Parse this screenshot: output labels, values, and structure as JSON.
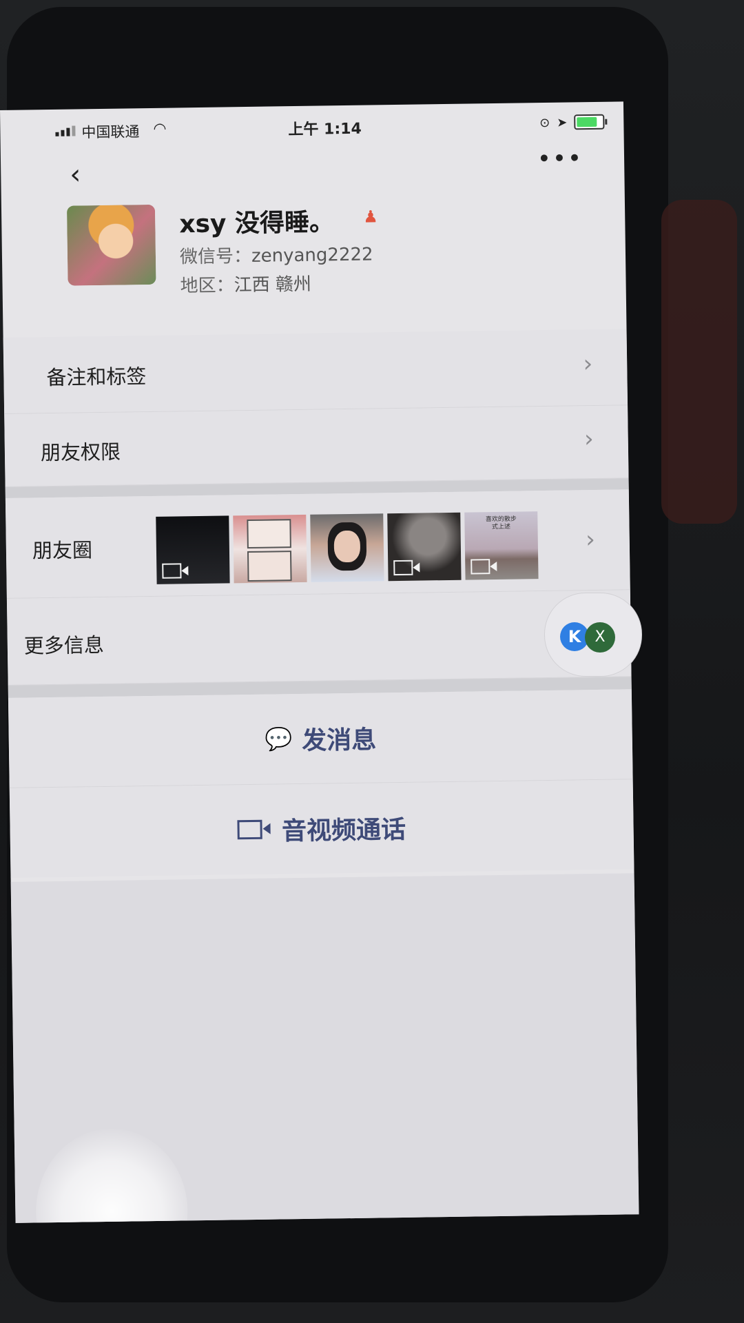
{
  "status_bar": {
    "carrier": "中国联通",
    "time": "上午 1:14",
    "battery_level": 0.8
  },
  "nav": {
    "back_glyph": "‹",
    "more_glyph": "•••"
  },
  "profile": {
    "nickname": "xsy 没得睡。",
    "wechat_id_label": "微信号：",
    "wechat_id": "zenyang2222",
    "region_label": "地区：",
    "region": "江西 赣州"
  },
  "rows": {
    "notes_tags": "备注和标签",
    "friend_permissions": "朋友权限",
    "moments": "朋友圈",
    "more_info": "更多信息"
  },
  "moments_thumbnails": [
    {
      "type": "video",
      "caption": ""
    },
    {
      "type": "image",
      "caption": ""
    },
    {
      "type": "image",
      "caption": ""
    },
    {
      "type": "video",
      "caption": ""
    },
    {
      "type": "video",
      "caption": "喜欢的散步\n式上述"
    }
  ],
  "floating_widget": {
    "k_label": "K",
    "x_label": "X"
  },
  "actions": {
    "send_message": "发消息",
    "video_call": "音视频通话"
  },
  "icons": {
    "chevron": "›",
    "message_icon": "💬",
    "wifi_icon": "◠",
    "gender_icon": "♟"
  },
  "colors": {
    "accent": "#3e4a78",
    "background": "#e3e2e6",
    "separator": "#cfcfd3"
  }
}
